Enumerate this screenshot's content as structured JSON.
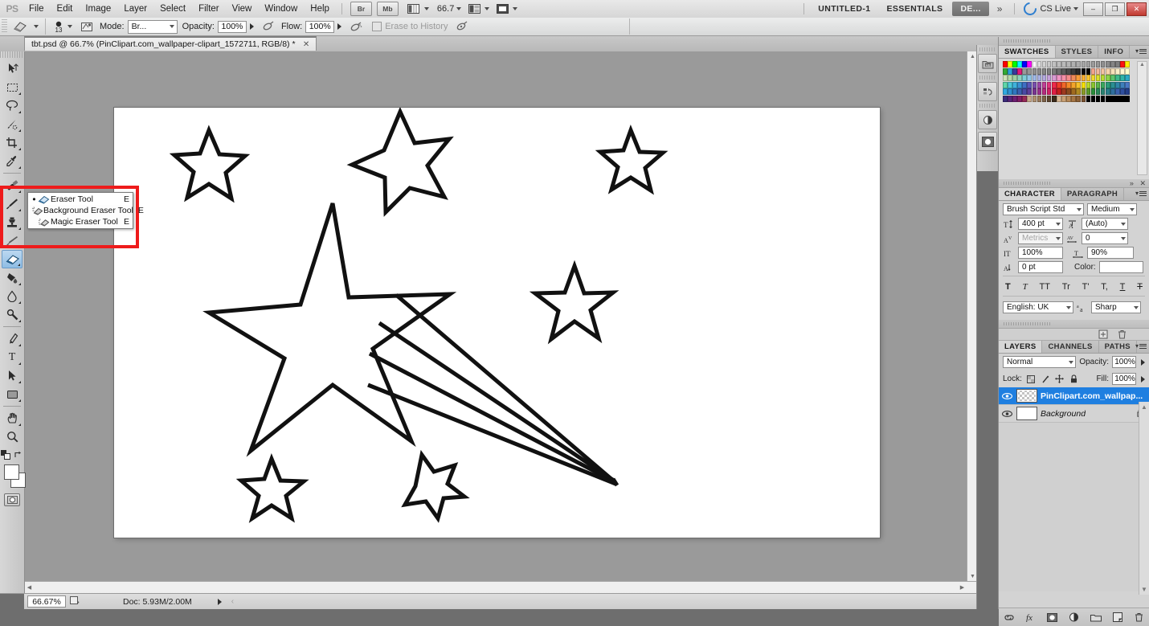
{
  "app": {
    "name": "Adobe Photoshop",
    "logo_text": "PS"
  },
  "menubar": {
    "items": [
      "File",
      "Edit",
      "Image",
      "Layer",
      "Select",
      "Filter",
      "View",
      "Window",
      "Help"
    ],
    "bridge_button": "Br",
    "minibridge_button": "Mb",
    "view_extras_icon": "view-extras-icon",
    "zoom_level": "66.7",
    "screen_mode_icon": "screen-mode-icon",
    "arrange_icon": "arrange-documents-icon",
    "document_name": "UNTITLED-1",
    "workspace_essentials": "ESSENTIALS",
    "workspace_design": "DE...",
    "workspace_more": "»",
    "cs_live": "CS Live",
    "win_minimize": "–",
    "win_restore": "❐",
    "win_close": "✕"
  },
  "optionsbar": {
    "tool_preset_icon": "eraser-tool-preset-icon",
    "brush_size": "13",
    "brush_panel_icon": "brush-panel-toggle-icon",
    "mode_label": "Mode:",
    "mode_value": "Br...",
    "opacity_label": "Opacity:",
    "opacity_value": "100%",
    "opacity_pressure_icon": "opacity-pressure-icon",
    "flow_label": "Flow:",
    "flow_value": "100%",
    "airbrush_icon": "airbrush-icon",
    "erase_to_history_label": "Erase to History",
    "tablet_pressure_icon": "tablet-pressure-icon"
  },
  "document_tab": {
    "title": "tbt.psd @ 66.7% (PinClipart.com_wallpaper-clipart_1572711, RGB/8) *",
    "close_icon": "close-icon"
  },
  "toolbar": {
    "tools": [
      {
        "name": "move-tool",
        "icon": "move-arrow",
        "has_flyout": false
      },
      {
        "name": "rectangular-marquee-tool",
        "icon": "marquee-dashed-rect",
        "has_flyout": true
      },
      {
        "name": "lasso-tool",
        "icon": "lasso",
        "has_flyout": true
      },
      {
        "name": "quick-selection-tool",
        "icon": "quick-select",
        "has_flyout": true
      },
      {
        "name": "crop-tool",
        "icon": "crop",
        "has_flyout": true
      },
      {
        "name": "eyedropper-tool",
        "icon": "eyedropper",
        "has_flyout": true
      },
      {
        "name": "spot-healing-brush-tool",
        "icon": "healing-brush",
        "has_flyout": true
      },
      {
        "name": "brush-tool",
        "icon": "paintbrush",
        "has_flyout": true
      },
      {
        "name": "clone-stamp-tool",
        "icon": "clone-stamp",
        "has_flyout": true
      },
      {
        "name": "history-brush-tool",
        "icon": "history-brush",
        "has_flyout": true
      },
      {
        "name": "eraser-tool",
        "icon": "eraser",
        "has_flyout": true,
        "selected": true
      },
      {
        "name": "gradient-tool",
        "icon": "paint-bucket",
        "has_flyout": true
      },
      {
        "name": "blur-tool",
        "icon": "blur-droplet",
        "has_flyout": true
      },
      {
        "name": "dodge-tool",
        "icon": "dodge",
        "has_flyout": true
      },
      {
        "name": "pen-tool",
        "icon": "pen-nib",
        "has_flyout": true
      },
      {
        "name": "horizontal-type-tool",
        "icon": "type-T",
        "has_flyout": true
      },
      {
        "name": "path-selection-tool",
        "icon": "path-arrow",
        "has_flyout": true
      },
      {
        "name": "rectangle-tool",
        "icon": "rectangle-shape",
        "has_flyout": true
      },
      {
        "name": "hand-tool",
        "icon": "hand",
        "has_flyout": true
      },
      {
        "name": "zoom-tool",
        "icon": "magnifier",
        "has_flyout": false
      }
    ],
    "default_colors_icon": "default-colors-icon",
    "swap_colors_icon": "swap-colors-icon",
    "foreground_color": "#ffffff",
    "background_color": "#ffffff",
    "quick_mask_icon": "quick-mask-mode-icon"
  },
  "tool_flyout": {
    "highlighted": true,
    "highlight_color": "#ee1b1b",
    "items": [
      {
        "label": "Eraser Tool",
        "shortcut": "E",
        "icon": "eraser-icon",
        "active": true
      },
      {
        "label": "Background Eraser Tool",
        "shortcut": "E",
        "icon": "background-eraser-icon",
        "active": false
      },
      {
        "label": "Magic Eraser Tool",
        "shortcut": "E",
        "icon": "magic-eraser-icon",
        "active": false
      }
    ]
  },
  "statusbar": {
    "zoom": "66.67%",
    "preview_icon": "document-preview-icon",
    "doc_info": "Doc: 5.93M/2.00M",
    "expand_icon": "status-expand-icon",
    "scroll_left_icon": "‹"
  },
  "dockstrip": {
    "buttons": [
      {
        "name": "mini-bridge-dock-icon",
        "label": "MB"
      },
      {
        "name": "history-dock-icon",
        "label": "H"
      },
      {
        "name": "adjustments-dock-icon",
        "label": "A"
      },
      {
        "name": "masks-dock-icon",
        "label": "M"
      }
    ]
  },
  "swatches_panel": {
    "tabs": [
      "SWATCHES",
      "STYLES",
      "INFO"
    ],
    "active_tab": "SWATCHES",
    "menu_icon": "panel-menu-icon",
    "colors": [
      "#ff0000",
      "#ffff00",
      "#00ff00",
      "#00ffff",
      "#0000ff",
      "#ff00ff",
      "#ffffff",
      "#dcdcdc",
      "#d2d2d2",
      "#c8c8c8",
      "#c0c0c0",
      "#bdbdbd",
      "#bababa",
      "#b5b5b5",
      "#b0b0b0",
      "#ababab",
      "#a6a6a6",
      "#a0a0a0",
      "#9b9b9b",
      "#969696",
      "#909090",
      "#8a8a8a",
      "#848484",
      "#7e7e7e",
      "#ff1111",
      "#ffee00",
      "#33aa33",
      "#2f9fd8",
      "#3a3a9c",
      "#e0197a",
      "#9a9a9a",
      "#959595",
      "#8f8f8f",
      "#8a8a8a",
      "#858585",
      "#7f7f7f",
      "#797979",
      "#6e6e6e",
      "#5a5a5a",
      "#4b4b4b",
      "#3a3a3a",
      "#2a2a2a",
      "#0a0a0a",
      "#000000",
      "#f3a58c",
      "#f0b79b",
      "#f2c4a2",
      "#f4d2ab",
      "#f6e0b9",
      "#f9eec8",
      "#fdf6d2",
      "#ffffcc",
      "#cfe2b8",
      "#b6d8a8",
      "#9fd0a2",
      "#8fd2bd",
      "#7fcfd6",
      "#8fc6e6",
      "#9fb9e8",
      "#a8b0e2",
      "#b2a8de",
      "#c4a0da",
      "#d89ad2",
      "#ee95c4",
      "#f58fa8",
      "#f58b8b",
      "#f08a5a",
      "#f59a3a",
      "#f7ae33",
      "#f9c52f",
      "#f0d92b",
      "#d8e02c",
      "#b6dc33",
      "#8ad24a",
      "#5cc46b",
      "#3db98b",
      "#2fb3a8",
      "#2aa9c4",
      "#5ed5a8",
      "#4ac8d8",
      "#3fb2dc",
      "#3a93d4",
      "#3f6fc4",
      "#5a57b8",
      "#7a4fae",
      "#9a46a6",
      "#c03f96",
      "#e0357e",
      "#ee2a4a",
      "#ef3d2a",
      "#f1662a",
      "#f3882a",
      "#f4a42a",
      "#f5c02a",
      "#f7e000",
      "#b8d92a",
      "#8ac62f",
      "#5ab54a",
      "#3aa85e",
      "#2a9b78",
      "#2a8f92",
      "#2f86a8",
      "#3d7fbb",
      "#4a78c4",
      "#2fa8e0",
      "#2f8fd0",
      "#2f76c0",
      "#3a5fb0",
      "#4a4aa4",
      "#5e3e9a",
      "#7a3590",
      "#98308a",
      "#b62a7e",
      "#d02268",
      "#e01e44",
      "#c41f1f",
      "#9e3a1f",
      "#8a4a1f",
      "#a06a1f",
      "#b08a22",
      "#8a9a26",
      "#5a9a2a",
      "#2a8f3a",
      "#2a8a5a",
      "#2a8472",
      "#2a7e8a",
      "#2f6f9e",
      "#3a62ae",
      "#2f4f9e",
      "#243f8a",
      "#3a2a7a",
      "#58247a",
      "#6e1f72",
      "#821c66",
      "#962a58",
      "#c9a98a",
      "#b09070",
      "#9a7a5a",
      "#7e6248",
      "#5e4630",
      "#3a2a1a",
      "#d8b894",
      "#c9a074",
      "#b88a58",
      "#a67644",
      "#8e6236",
      "#7a5230",
      "#000000",
      "#000000",
      "#000000",
      "#000000",
      "#000000",
      "#000000",
      "#000000",
      "#000000",
      "#000000"
    ]
  },
  "character_panel": {
    "tabs": [
      "CHARACTER",
      "PARAGRAPH"
    ],
    "active_tab": "CHARACTER",
    "collapse_icon": "collapse-panel-icon",
    "close_icon": "close-icon",
    "menu_icon": "panel-menu-icon",
    "font_family": "Brush Script Std",
    "font_style": "Medium",
    "font_size_icon": "font-size-icon",
    "font_size": "400 pt",
    "leading_icon": "leading-icon",
    "leading": "(Auto)",
    "kerning_icon": "kerning-icon",
    "kerning": "Metrics",
    "tracking_icon": "tracking-icon",
    "tracking": "0",
    "vertical_scale_icon": "vertical-scale-icon",
    "vertical_scale": "100%",
    "horizontal_scale_icon": "horizontal-scale-icon",
    "horizontal_scale": "90%",
    "baseline_icon": "baseline-shift-icon",
    "baseline_shift": "0 pt",
    "color_label": "Color:",
    "text_color": "#ffffff",
    "style_buttons": [
      "T",
      "T",
      "TT",
      "Tr",
      "T'",
      "T,",
      "T",
      "T"
    ],
    "style_button_names": [
      "faux-bold",
      "faux-italic",
      "all-caps",
      "small-caps",
      "superscript",
      "subscript",
      "underline",
      "strikethrough"
    ],
    "language": "English: UK",
    "aa_icon": "anti-alias-icon",
    "anti_alias": "Sharp"
  },
  "layers_panel": {
    "tabs": [
      "LAYERS",
      "CHANNELS",
      "PATHS"
    ],
    "active_tab": "LAYERS",
    "menu_icon": "panel-menu-icon",
    "top_icons": [
      "new-adjustment-layer-icon",
      "delete-icon"
    ],
    "blend_mode": "Normal",
    "opacity_label": "Opacity:",
    "opacity_value": "100%",
    "lock_label": "Lock:",
    "lock_icons": [
      "lock-transparent-pixels-icon",
      "lock-image-pixels-icon",
      "lock-position-icon",
      "lock-all-icon"
    ],
    "fill_label": "Fill:",
    "fill_value": "100%",
    "layers": [
      {
        "name": "PinClipart.com_wallpap...",
        "visible": true,
        "selected": true,
        "thumb": "checker",
        "locked": false
      },
      {
        "name": "Background",
        "visible": true,
        "selected": false,
        "thumb": "white",
        "locked": true
      }
    ],
    "footer_icons": [
      "link-layers-icon",
      "layer-style-fx-icon",
      "add-layer-mask-icon",
      "new-adjustment-layer-icon",
      "new-group-icon",
      "new-layer-icon",
      "delete-layer-icon"
    ]
  },
  "canvas": {
    "artwork_name": "shooting-star-line-art",
    "background": "#ffffff",
    "stroke_color": "#111111"
  }
}
